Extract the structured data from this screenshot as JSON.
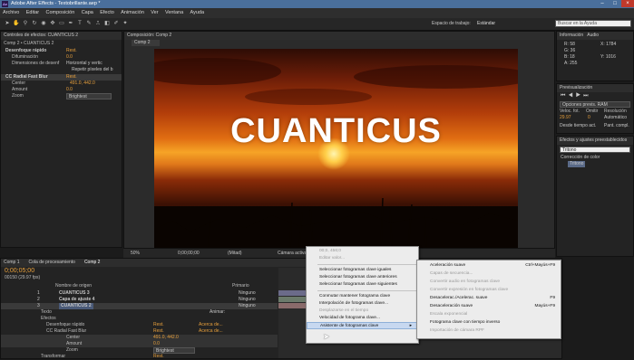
{
  "window": {
    "title": "Adobe After Effects - Textobrillante.aep *",
    "logo": "Ae"
  },
  "menu": [
    "Archivo",
    "Editar",
    "Composición",
    "Capa",
    "Efecto",
    "Animación",
    "Ver",
    "Ventana",
    "Ayuda"
  ],
  "toolbar": {
    "workspace_label": "Espacio de trabajo:",
    "workspace_value": "Estándar",
    "search_placeholder": "Buscar en la Ayuda"
  },
  "effects_panel": {
    "tab": "Controles de efectos: CUANTICUS 2",
    "path": "Comp 2 • CUANTICUS 2",
    "rows": [
      {
        "name": "Desenfoque rápido",
        "value": "Rest."
      },
      {
        "name": "Difuminación",
        "value": "0.0"
      },
      {
        "name": "Dimensiones de desenf",
        "value": "Horizontal y vertic"
      },
      {
        "name": "",
        "value": "Repetir píxeles del b"
      },
      {
        "name": "CC Radial Fast Blur",
        "value": "Rest."
      },
      {
        "name": "Center",
        "value": "491.0, 442.0"
      },
      {
        "name": "Amount",
        "value": "0.0"
      },
      {
        "name": "Zoom",
        "value": "Brightest"
      }
    ]
  },
  "viewer": {
    "tab": "Composición: Comp 2",
    "sub_tab": "Comp 2",
    "headline": "CUANTICUS",
    "zoom": "50%",
    "timecode": "0;00;00;00",
    "resolution": "(Mitad)",
    "camera": "Cámara activa"
  },
  "info_panel": {
    "tab": "Información",
    "tab2": "Audio",
    "r": "58",
    "g": "36",
    "b": "18",
    "a": "255",
    "x": "X: 1784",
    "y": "Y: 1016"
  },
  "preview_panel": {
    "tab": "Previsualización",
    "options_label": "Opciones previs. RAM",
    "fps_label": "Veloc. fot.",
    "skip_label": "Omitir",
    "res_label": "Resolución",
    "fps_value": "29.97",
    "skip_value": "0",
    "res_value": "Automático",
    "from_current": "Desde tiempo act.",
    "full_screen": "Pant. compl."
  },
  "effects_presets": {
    "tab": "Efectos y ajustes preestablecidos",
    "search": "Tritono",
    "category": "Corrección de color",
    "item": "Tritono"
  },
  "timeline": {
    "tabs": [
      "Comp 1",
      "Cola de procesamiento",
      "Comp 2"
    ],
    "timecode": "0;00;05;00",
    "fps": "00150 (29.97 fps)",
    "columns": [
      "Nombre de origen",
      "Primario"
    ],
    "layers": [
      {
        "num": "1",
        "name": "CUANTICUS 3",
        "parent": "Ninguno"
      },
      {
        "num": "2",
        "name": "Capa de ajuste 4",
        "parent": "Ninguno"
      },
      {
        "num": "3",
        "name": "CUANTICUS 2",
        "parent": "Ninguno"
      }
    ],
    "props": [
      {
        "name": "Texto",
        "value": "Animar:"
      },
      {
        "name": "Efectos",
        "value": ""
      },
      {
        "name": "Desenfoque rápido",
        "value": "Rest."
      },
      {
        "name": "CC Radial Fast Blur",
        "value": "Rest."
      },
      {
        "name": "Center",
        "value": "491.0, 442.0"
      },
      {
        "name": "Amount",
        "value": "0.0"
      },
      {
        "name": "Zoom",
        "value": "Brightest"
      },
      {
        "name": "Transformar",
        "value": "Rest."
      }
    ],
    "animate_label": "Acerca de...",
    "ruler": "rs"
  },
  "context_menu": {
    "items": [
      {
        "label": "00;0, 456;0",
        "disabled": true
      },
      {
        "label": "Editar valor...",
        "disabled": true
      },
      {
        "sep": true
      },
      {
        "label": "Seleccionar fotogramas clave iguales"
      },
      {
        "label": "Seleccionar fotogramas clave anteriores"
      },
      {
        "label": "Seleccionar fotogramas clave siguientes"
      },
      {
        "sep": true
      },
      {
        "label": "Conmutar mantener fotograma clave"
      },
      {
        "label": "Interpolación de fotogramas clave..."
      },
      {
        "label": "Desplazarse en el tiempo",
        "disabled": true
      },
      {
        "label": "Velocidad de fotograma clave..."
      },
      {
        "label": "Asistente de fotogramas clave",
        "highlight": true,
        "submenu": true
      }
    ]
  },
  "submenu": {
    "items": [
      {
        "label": "Aceleración suave",
        "shortcut": "Ctrl+Mayús+F9"
      },
      {
        "label": "Capas de secuencia...",
        "disabled": true
      },
      {
        "label": "Convertir audio en fotogramas clave",
        "disabled": true
      },
      {
        "label": "Convertir expresión en fotogramas clave",
        "disabled": true
      },
      {
        "label": "Desacelerac./Acelerac. suave",
        "shortcut": "F9"
      },
      {
        "label": "Desaceleración suave",
        "shortcut": "Mayús+F9"
      },
      {
        "label": "Escala exponencial",
        "disabled": true
      },
      {
        "label": "Fotograma clave con tiempo inverso"
      },
      {
        "label": "Importación de cámara RPF",
        "disabled": true
      }
    ]
  },
  "colors": {
    "accent": "#e8a03c",
    "titlebar": "#4a6f9c",
    "menu_highlight": "#c7d8f0"
  }
}
